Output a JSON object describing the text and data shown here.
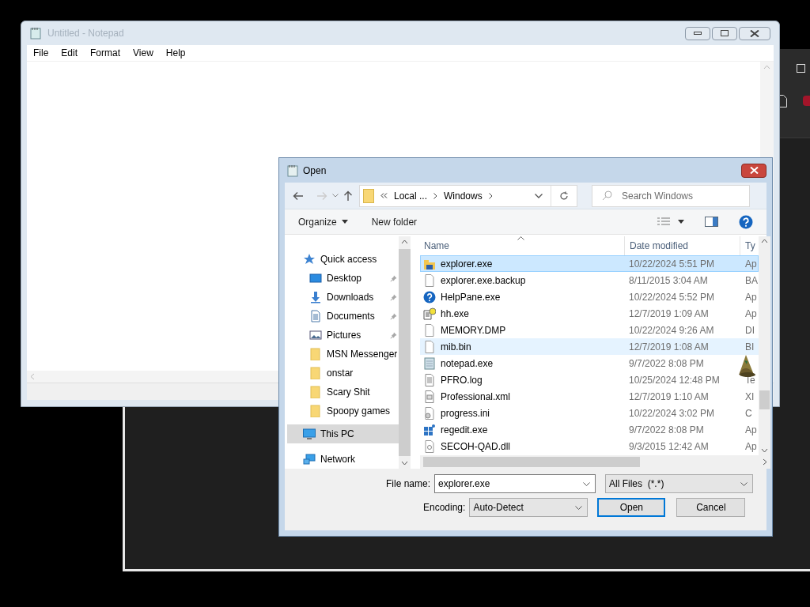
{
  "notepad": {
    "title": "Untitled - Notepad",
    "menu": [
      "File",
      "Edit",
      "Format",
      "View",
      "Help"
    ]
  },
  "dialog": {
    "title": "Open",
    "breadcrumb": [
      "Local ...",
      "Windows"
    ],
    "search": {
      "placeholder": "Search Windows"
    },
    "toolbar": [
      "Organize",
      "New folder"
    ],
    "nav": [
      {
        "label": "Quick access",
        "kind": "star",
        "selected": false,
        "pinned": false,
        "children": [
          {
            "label": "Desktop",
            "kind": "desktop",
            "selected": false,
            "pinned": true
          },
          {
            "label": "Downloads",
            "kind": "download",
            "selected": false,
            "pinned": true
          },
          {
            "label": "Documents",
            "kind": "documents",
            "selected": false,
            "pinned": true
          },
          {
            "label": "Pictures",
            "kind": "pictures",
            "selected": false,
            "pinned": true
          },
          {
            "label": "MSN Messenger",
            "kind": "folder",
            "selected": false,
            "pinned": false
          },
          {
            "label": "onstar",
            "kind": "folder",
            "selected": false,
            "pinned": false
          },
          {
            "label": "Scary Shit",
            "kind": "folder",
            "selected": false,
            "pinned": false
          },
          {
            "label": "Spoopy games",
            "kind": "folder",
            "selected": false,
            "pinned": false
          }
        ]
      },
      {
        "label": "This PC",
        "kind": "pc",
        "selected": true,
        "pinned": false
      },
      {
        "label": "Network",
        "kind": "network",
        "selected": false,
        "pinned": false
      }
    ],
    "columns": [
      "Name",
      "Date modified",
      "Ty"
    ],
    "rows": [
      {
        "name": "explorer.exe",
        "date": "10/22/2024 5:51 PM",
        "type": "Ap",
        "kind": "explorer",
        "selected": true,
        "hovered": false
      },
      {
        "name": "explorer.exe.backup",
        "date": "8/11/2015 3:04 AM",
        "type": "BA",
        "kind": "file",
        "selected": false,
        "hovered": false
      },
      {
        "name": "HelpPane.exe",
        "date": "10/22/2024 5:52 PM",
        "type": "Ap",
        "kind": "help",
        "selected": false,
        "hovered": false
      },
      {
        "name": "hh.exe",
        "date": "12/7/2019 1:09 AM",
        "type": "Ap",
        "kind": "helpdoc",
        "selected": false,
        "hovered": false
      },
      {
        "name": "MEMORY.DMP",
        "date": "10/22/2024 9:26 AM",
        "type": "DI",
        "kind": "file",
        "selected": false,
        "hovered": false
      },
      {
        "name": "mib.bin",
        "date": "12/7/2019 1:08 AM",
        "type": "BI",
        "kind": "file",
        "selected": false,
        "hovered": true
      },
      {
        "name": "notepad.exe",
        "date": "9/7/2022 8:08 PM",
        "kind": "notepad",
        "selected": false,
        "hovered": false
      },
      {
        "name": "PFRO.log",
        "date": "10/25/2024 12:48 PM",
        "type": "Te",
        "kind": "text",
        "selected": false,
        "hovered": false
      },
      {
        "name": "Professional.xml",
        "date": "12/7/2019 1:10 AM",
        "type": "XI",
        "kind": "xml",
        "selected": false,
        "hovered": false
      },
      {
        "name": "progress.ini",
        "date": "10/22/2024 3:02 PM",
        "type": "C",
        "kind": "config",
        "selected": false,
        "hovered": false
      },
      {
        "name": "regedit.exe",
        "date": "9/7/2022 8:08 PM",
        "type": "Ap",
        "kind": "regedit",
        "selected": false,
        "hovered": false
      },
      {
        "name": "SECOH-QAD.dll",
        "date": "9/3/2015 12:42 AM",
        "type": "Ap",
        "kind": "dll",
        "selected": false,
        "hovered": false
      }
    ],
    "file_name": {
      "label": "File name:",
      "value": "explorer.exe"
    },
    "file_type": "All Files  (*.*)",
    "encoding": {
      "label": "Encoding:",
      "value": "Auto-Detect"
    },
    "buttons": [
      "Open",
      "Cancel"
    ]
  }
}
